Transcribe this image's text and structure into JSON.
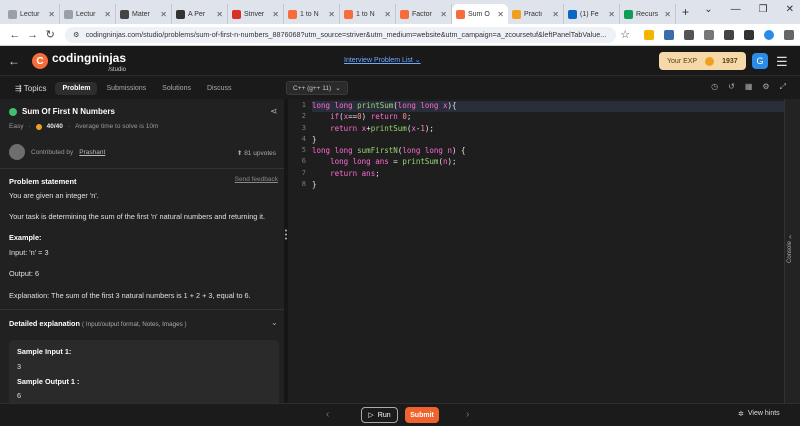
{
  "browser": {
    "tabs": [
      {
        "label": "Lectur",
        "color": "#9aa0a6"
      },
      {
        "label": "Lectur",
        "color": "#9aa0a6"
      },
      {
        "label": "Mater",
        "color": "#444444"
      },
      {
        "label": "A Per",
        "color": "#333333"
      },
      {
        "label": "Striver",
        "color": "#d93025"
      },
      {
        "label": "1 to N",
        "color": "#f66c3b"
      },
      {
        "label": "1 to N",
        "color": "#f66c3b"
      },
      {
        "label": "Factor",
        "color": "#f66c3b"
      },
      {
        "label": "Sum O",
        "color": "#f66c3b",
        "active": true
      },
      {
        "label": "Practi",
        "color": "#f0a020"
      },
      {
        "label": "(1) Fe",
        "color": "#0a66c2"
      },
      {
        "label": "Recurs",
        "color": "#0f9d58"
      }
    ],
    "new_tab": "+",
    "url": "codingninjas.com/studio/problems/sum-of-first-n-numbers_8876068?utm_source=striver&utm_medium=website&utm_campaign=a_zcoursetuf&leftPanelTabValue..."
  },
  "header": {
    "brand": "codingninjas",
    "brand_sub": "/studio",
    "interview_list": "Interview Problem List",
    "exp_label": "Your EXP",
    "exp_value": "1937",
    "avatar": "G"
  },
  "toolbar": {
    "topics": "Topics",
    "tabs": [
      "Problem",
      "Submissions",
      "Solutions",
      "Discuss"
    ],
    "language": "C++ (g++ 11)"
  },
  "problem": {
    "title": "Sum Of First N Numbers",
    "difficulty": "Easy",
    "score": "40/40",
    "avg_time": "Average time to solve is 10m",
    "contributed_label": "Contributed by",
    "contributor": "Prashant",
    "upvotes": "81 upvotes",
    "statement_heading": "Problem statement",
    "feedback": "Send feedback",
    "line1": "You are given an integer 'n'.",
    "line2": "Your task is determining the sum of the first 'n' natural numbers and returning it.",
    "example_heading": "Example:",
    "input": "Input: 'n' = 3",
    "output": "Output: 6",
    "explanation": "Explanation: The sum of the first 3 natural numbers is 1 + 2 + 3, equal to 6.",
    "detailed_heading": "Detailed explanation",
    "detailed_sub": "( Input/output format, Notes, Images )",
    "sample_input_heading": "Sample Input 1:",
    "sample_input_value": "3",
    "sample_output_heading": "Sample Output 1 :",
    "sample_output_value": "6"
  },
  "editor": {
    "line_numbers": [
      "1",
      "2",
      "3",
      "4",
      "5",
      "6",
      "7",
      "8"
    ],
    "lines": [
      "long long printSum(long long x){",
      "    if(x==0) return 0;",
      "    return x+printSum(x-1);",
      "}",
      "long long sumFirstN(long long n) {",
      "    long long ans = printSum(n);",
      "    return ans;",
      "}"
    ]
  },
  "console_label": "Console",
  "footer": {
    "run": "Run",
    "submit": "Submit",
    "hints": "View hints"
  }
}
